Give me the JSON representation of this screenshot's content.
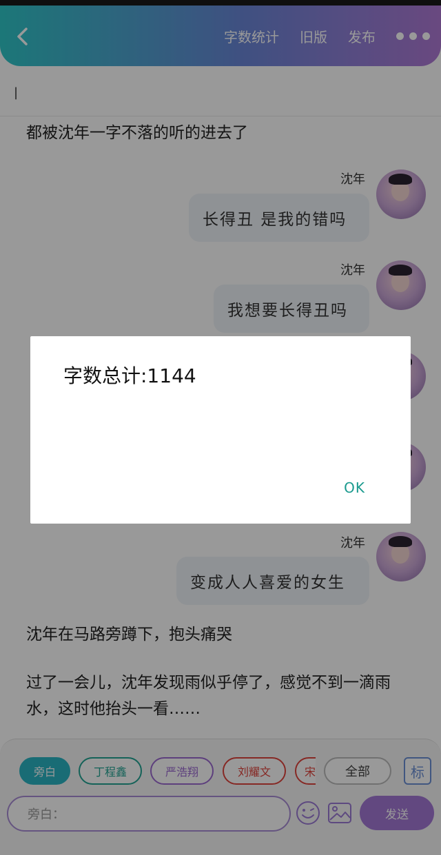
{
  "header": {
    "actions": [
      "字数统计",
      "旧版",
      "发布"
    ]
  },
  "editor": {
    "cursor_text": "|"
  },
  "messages": [
    {
      "type": "narration",
      "text": "都被沈年一字不落的听的进去了"
    },
    {
      "type": "dialogue",
      "speaker": "沈年",
      "text": "长得丑 是我的错吗"
    },
    {
      "type": "dialogue",
      "speaker": "沈年",
      "text": "我想要长得丑吗"
    },
    {
      "type": "dialogue",
      "speaker": "沈年",
      "text": "变成人人喜爱的女生"
    },
    {
      "type": "narration",
      "text": "沈年在马路旁蹲下，抱头痛哭"
    },
    {
      "type": "narration",
      "text": "过了一会儿，沈年发现雨似乎停了，感觉不到一滴雨水，这时他抬头一看……"
    }
  ],
  "dialog": {
    "text": "字数总计:1144",
    "ok_label": "OK"
  },
  "bottom": {
    "chips": [
      {
        "label": "旁白",
        "color": "#2bb5c4",
        "selected": true
      },
      {
        "label": "丁程鑫",
        "color": "#22a393",
        "selected": false
      },
      {
        "label": "严浩翔",
        "color": "#9c6ad1",
        "selected": false
      },
      {
        "label": "刘耀文",
        "color": "#e0443c",
        "selected": false
      },
      {
        "label": "宋",
        "color": "#e0443c",
        "selected": false
      }
    ],
    "all_label": "全部",
    "mark_label": "标",
    "input_placeholder": "旁白：",
    "send_label": "发送"
  },
  "colors": {
    "header_gradient_start": "#2fc7c9",
    "header_gradient_end": "#b07ad6",
    "ok_color": "#1a9a8e",
    "send_bg": "#a478d6"
  }
}
